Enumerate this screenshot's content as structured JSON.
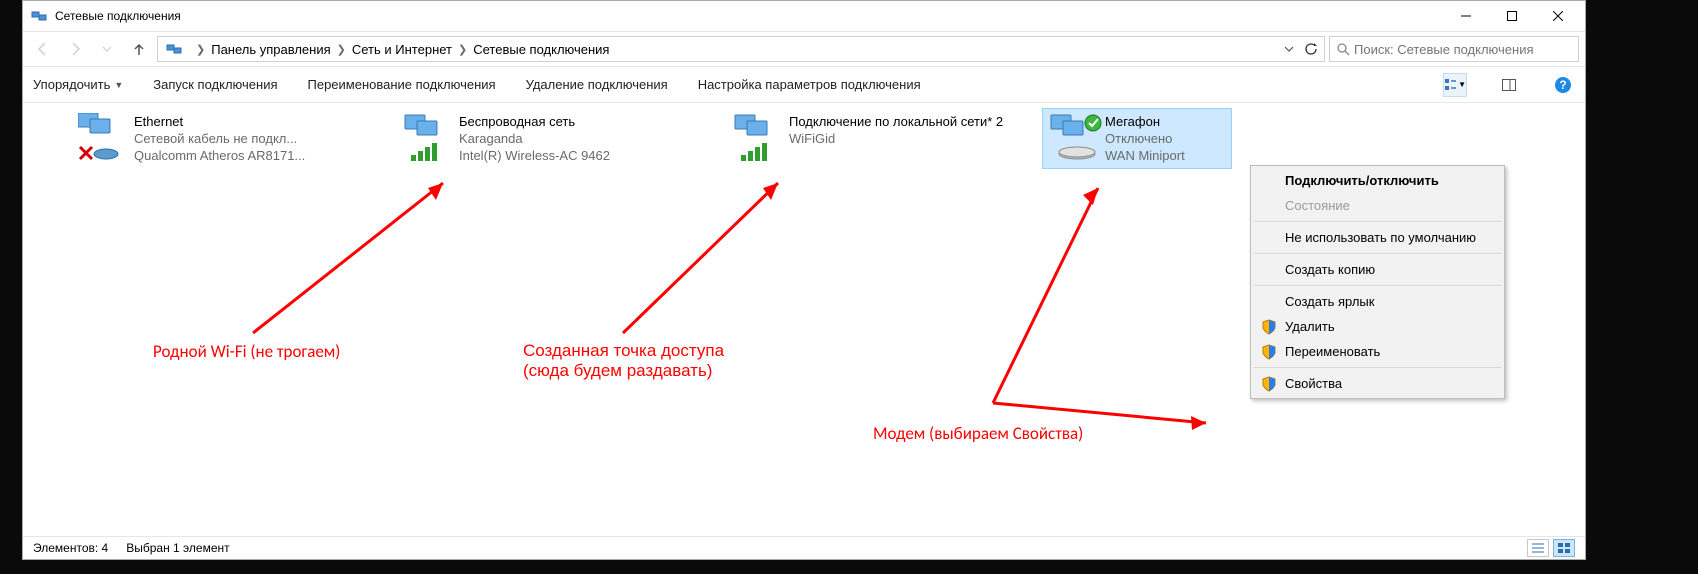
{
  "window": {
    "title": "Сетевые подключения"
  },
  "breadcrumbs": {
    "seg1": "Панель управления",
    "seg2": "Сеть и Интернет",
    "seg3": "Сетевые подключения"
  },
  "search": {
    "placeholder": "Поиск: Сетевые подключения"
  },
  "toolbar": {
    "organize": "Упорядочить",
    "start_conn": "Запуск подключения",
    "rename_conn": "Переименование подключения",
    "delete_conn": "Удаление подключения",
    "conn_settings": "Настройка параметров подключения"
  },
  "connections": [
    {
      "name": "Ethernet",
      "line2": "Сетевой кабель не подкл...",
      "line3": "Qualcomm Atheros AR8171..."
    },
    {
      "name": "Беспроводная сеть",
      "line2": "Karaganda",
      "line3": "Intel(R) Wireless-AC 9462"
    },
    {
      "name": "Подключение по локальной сети* 2",
      "line2": "WiFiGid",
      "line3": ""
    },
    {
      "name": "Мегафон",
      "line2": "Отключено",
      "line3": "WAN Miniport"
    }
  ],
  "ctxmenu": {
    "connect": "Подключить/отключить",
    "status": "Состояние",
    "nodefault": "Не использовать по умолчанию",
    "copy": "Создать копию",
    "shortcut": "Создать ярлык",
    "delete": "Удалить",
    "rename": "Переименовать",
    "props": "Свойства"
  },
  "annotations": {
    "a1": "Родной Wi-Fi (не трогаем)",
    "a2_l1": "Созданная точка доступа",
    "a2_l2": "(сюда будем раздавать)",
    "a3": "Модем (выбираем Свойства)"
  },
  "statusbar": {
    "count": "Элементов: 4",
    "sel": "Выбран 1 элемент"
  }
}
